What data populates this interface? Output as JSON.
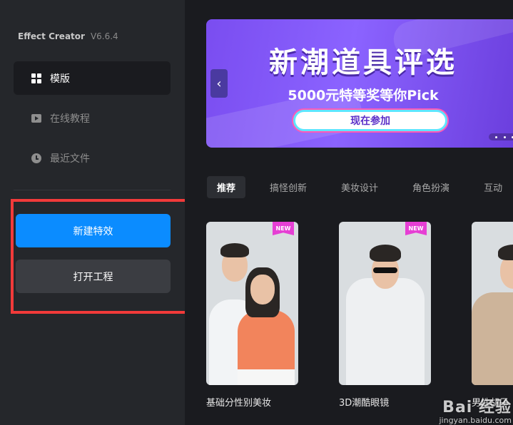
{
  "app": {
    "name": "Effect Creator",
    "version": "V6.6.4"
  },
  "sidebar": {
    "items": [
      {
        "label": "模版",
        "icon": "grid-icon",
        "active": true
      },
      {
        "label": "在线教程",
        "icon": "play-icon",
        "active": false
      },
      {
        "label": "最近文件",
        "icon": "clock-icon",
        "active": false
      }
    ],
    "new_effect_label": "新建特效",
    "open_project_label": "打开工程"
  },
  "banner": {
    "title": "新潮道具评选",
    "subtitle": "5000元特等奖等你Pick",
    "cta": "现在参加",
    "prev_glyph": "‹"
  },
  "tabs": [
    {
      "label": "推荐",
      "active": true
    },
    {
      "label": "搞怪创新",
      "active": false
    },
    {
      "label": "美妆设计",
      "active": false
    },
    {
      "label": "角色扮演",
      "active": false
    },
    {
      "label": "互动",
      "active": false
    }
  ],
  "templates": [
    {
      "title": "基础分性别美妆",
      "badge": "NEW"
    },
    {
      "title": "3D潮酷眼镜",
      "badge": "NEW"
    },
    {
      "title": "男性胡子",
      "badge": ""
    }
  ],
  "watermark": {
    "brand": "Bai 经验",
    "url": "jingyan.baidu.com"
  },
  "colors": {
    "accent": "#0b8cff",
    "highlight": "#f23a3a",
    "badge": "#e63fd4",
    "banner": "#7a4df0"
  }
}
